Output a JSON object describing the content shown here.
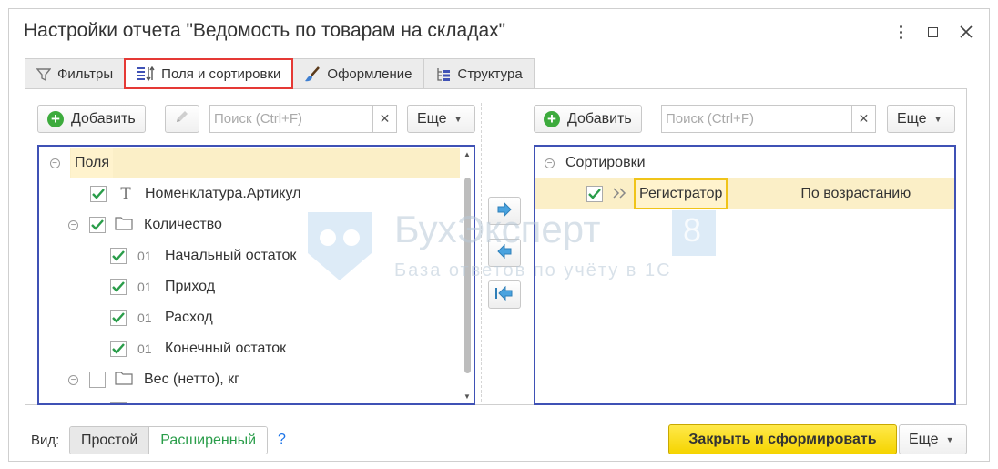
{
  "window": {
    "title": "Настройки отчета \"Ведомость по товарам на складах\""
  },
  "tabs": [
    {
      "label": "Фильтры",
      "icon": "filter-icon",
      "active": false
    },
    {
      "label": "Поля и сортировки",
      "icon": "fields-sort-icon",
      "active": true
    },
    {
      "label": "Оформление",
      "icon": "brush-icon",
      "active": false
    },
    {
      "label": "Структура",
      "icon": "structure-icon",
      "active": false
    }
  ],
  "left": {
    "add_label": "Добавить",
    "search_placeholder": "Поиск (Ctrl+F)",
    "more_label": "Еще",
    "tree": [
      {
        "label": "Поля",
        "icon": "",
        "checked": null,
        "level": 0,
        "selected": true
      },
      {
        "label": "Номенклатура.Артикул",
        "icon": "T",
        "checked": true,
        "level": 1
      },
      {
        "label": "Количество",
        "icon": "folder",
        "checked": true,
        "level": 1,
        "group": true
      },
      {
        "label": "Начальный остаток",
        "icon": "01",
        "checked": true,
        "level": 2
      },
      {
        "label": "Приход",
        "icon": "01",
        "checked": true,
        "level": 2
      },
      {
        "label": "Расход",
        "icon": "01",
        "checked": true,
        "level": 2
      },
      {
        "label": "Конечный остаток",
        "icon": "01",
        "checked": true,
        "level": 2
      },
      {
        "label": "Вес (нетто), кг",
        "icon": "folder",
        "checked": false,
        "level": 1,
        "group": true
      }
    ]
  },
  "right": {
    "add_label": "Добавить",
    "search_placeholder": "Поиск (Ctrl+F)",
    "more_label": "Еще",
    "root_label": "Сортировки",
    "item": {
      "label": "Регистратор",
      "direction": "По возрастанию",
      "checked": true
    }
  },
  "watermark": {
    "brand": "БухЭксперт",
    "number": "8",
    "tagline": "База ответов по учёту в 1С"
  },
  "footer": {
    "view_label": "Вид:",
    "simple_label": "Простой",
    "extended_label": "Расширенный",
    "help_label": "?",
    "primary_label": "Закрыть и сформировать",
    "more_label": "Еще"
  },
  "colors": {
    "accent_blue": "#3f51b5",
    "check_green": "#2a9d4a",
    "primary_yellow": "#f5d400",
    "active_tab_border": "#e53935"
  }
}
